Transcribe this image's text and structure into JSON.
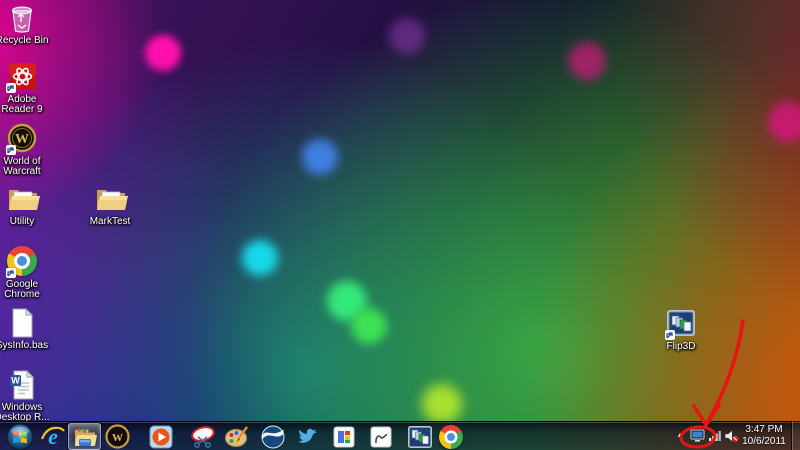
{
  "desktop": {
    "icons": [
      {
        "label": "Recycle Bin",
        "icon": "recycle-bin"
      },
      {
        "label": "Adobe Reader 9",
        "icon": "adobe-reader"
      },
      {
        "label": "World of Warcraft",
        "icon": "world-of-warcraft"
      },
      {
        "label": "Utility",
        "icon": "folder"
      },
      {
        "label": "MarkTest",
        "icon": "folder"
      },
      {
        "label": "Google Chrome",
        "icon": "google-chrome"
      },
      {
        "label": "SysInfo.bas",
        "icon": "bas-file"
      },
      {
        "label": "Windows Desktop R...",
        "icon": "word-document"
      },
      {
        "label": "Flip3D",
        "icon": "flip3d"
      }
    ]
  },
  "taskbar": {
    "items": [
      {
        "name": "start",
        "icon": "windows-orb"
      },
      {
        "name": "internet-explorer",
        "icon": "ie-logo"
      },
      {
        "name": "windows-explorer",
        "icon": "folder",
        "active": true
      },
      {
        "name": "world-of-warcraft",
        "icon": "wow-ring"
      },
      {
        "name": "media-player",
        "icon": "play-button"
      },
      {
        "name": "snipping-tool",
        "icon": "scissors"
      },
      {
        "name": "paint",
        "icon": "palette"
      },
      {
        "name": "bird-circle-app",
        "icon": "bird-in-circle"
      },
      {
        "name": "twitter",
        "icon": "twitter-bird"
      },
      {
        "name": "google-app",
        "icon": "google-mosaic"
      },
      {
        "name": "flag-glyph-app",
        "icon": "flag-squiggle"
      },
      {
        "name": "flip3d",
        "icon": "stacked-windows"
      },
      {
        "name": "chrome",
        "icon": "chrome-ball"
      }
    ]
  },
  "tray": {
    "time": "3:47 PM",
    "date": "10/6/2011",
    "icons": [
      "show-hidden-icons",
      "display",
      "wireless-signal",
      "volume-muted"
    ]
  },
  "annotation": {
    "color": "#e81414",
    "shape": "hand-drawn arrow and circle",
    "target": "show-hidden-icons-button"
  }
}
